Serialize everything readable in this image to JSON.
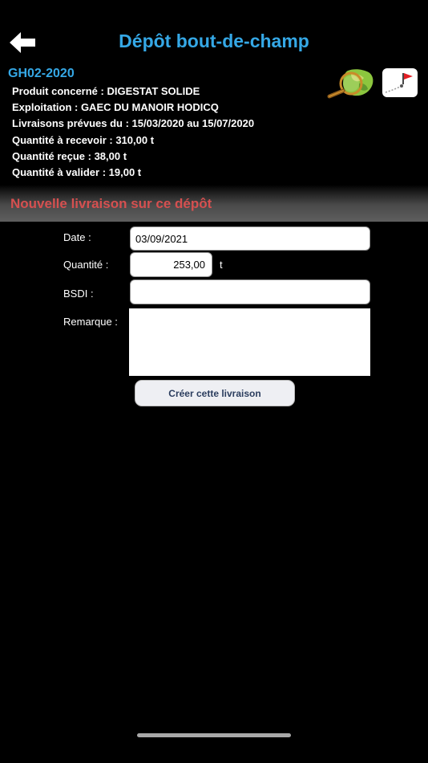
{
  "header": {
    "title": "Dépôt bout-de-champ"
  },
  "depot": {
    "code": "GH02-2020",
    "lines": [
      "Produit concerné : DIGESTAT SOLIDE",
      "Exploitation : GAEC DU MANOIR HODICQ",
      "Livraisons prévues du : 15/03/2020 au 15/07/2020",
      "Quantité à recevoir : 310,00 t",
      "Quantité reçue : 38,00 t",
      "Quantité à valider : 19,00 t"
    ]
  },
  "section": {
    "title": "Nouvelle livraison sur ce dépôt"
  },
  "form": {
    "date_label": "Date :",
    "date_value": "03/09/2021",
    "qty_label": "Quantité :",
    "qty_value": "253,00",
    "qty_unit": "t",
    "bsdi_label": "BSDI :",
    "bsdi_value": "",
    "remark_label": "Remarque :",
    "remark_value": "",
    "submit_label": "Créer cette livraison"
  },
  "icons": {
    "back": "arrow-left-icon",
    "map": "map-magnifier-icon",
    "flag": "flag-marker-icon"
  },
  "colors": {
    "title": "#35a8e6",
    "section_title": "#d55050",
    "background": "#000000"
  }
}
